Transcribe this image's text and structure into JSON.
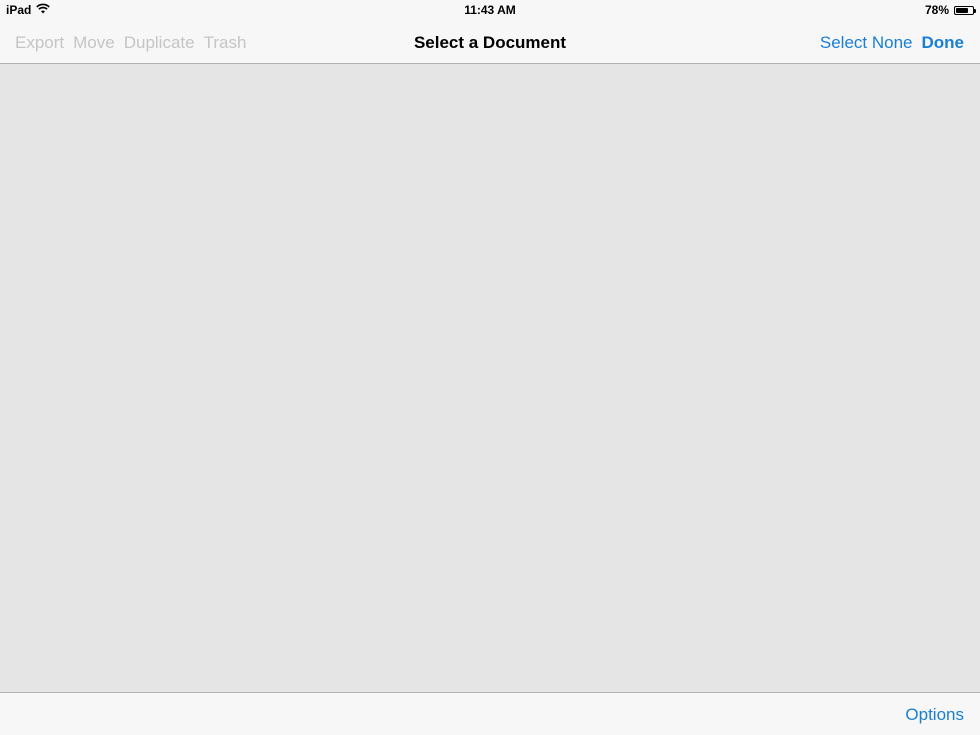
{
  "status_bar": {
    "device": "iPad",
    "time": "11:43 AM",
    "battery_percent": "78%",
    "battery_level": 0.78,
    "wifi_icon": "wifi-icon",
    "battery_icon": "battery-icon"
  },
  "nav_bar": {
    "title": "Select a Document",
    "left_actions": [
      "Export",
      "Move",
      "Duplicate",
      "Trash"
    ],
    "select_none_label": "Select None",
    "done_label": "Done"
  },
  "toolbar": {
    "options_label": "Options"
  },
  "colors": {
    "accent": "#1a7fd4",
    "disabled": "#c5c5c5",
    "background": "#e5e5e5",
    "bar": "#f7f7f7"
  }
}
